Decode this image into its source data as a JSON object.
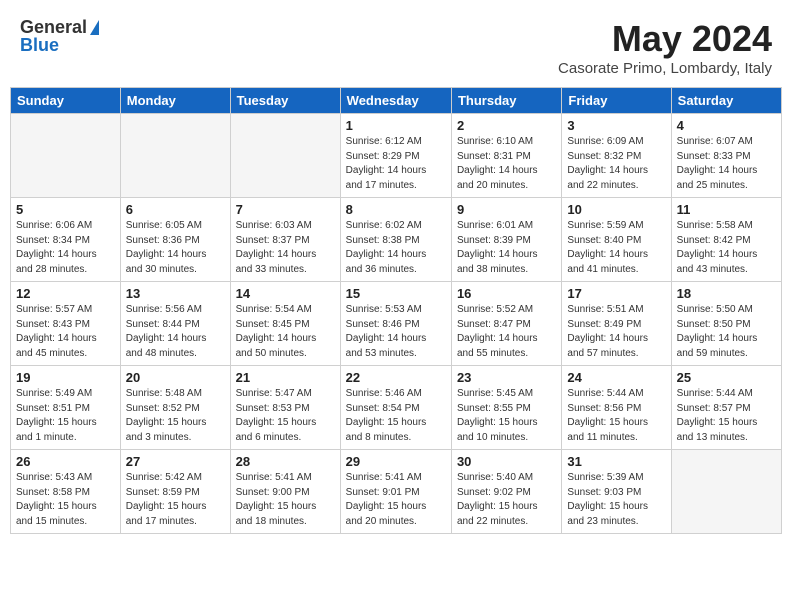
{
  "header": {
    "logo_general": "General",
    "logo_blue": "Blue",
    "month_title": "May 2024",
    "location": "Casorate Primo, Lombardy, Italy"
  },
  "weekdays": [
    "Sunday",
    "Monday",
    "Tuesday",
    "Wednesday",
    "Thursday",
    "Friday",
    "Saturday"
  ],
  "days": [
    {
      "num": "",
      "info": ""
    },
    {
      "num": "",
      "info": ""
    },
    {
      "num": "",
      "info": ""
    },
    {
      "num": "1",
      "info": "Sunrise: 6:12 AM\nSunset: 8:29 PM\nDaylight: 14 hours\nand 17 minutes."
    },
    {
      "num": "2",
      "info": "Sunrise: 6:10 AM\nSunset: 8:31 PM\nDaylight: 14 hours\nand 20 minutes."
    },
    {
      "num": "3",
      "info": "Sunrise: 6:09 AM\nSunset: 8:32 PM\nDaylight: 14 hours\nand 22 minutes."
    },
    {
      "num": "4",
      "info": "Sunrise: 6:07 AM\nSunset: 8:33 PM\nDaylight: 14 hours\nand 25 minutes."
    },
    {
      "num": "5",
      "info": "Sunrise: 6:06 AM\nSunset: 8:34 PM\nDaylight: 14 hours\nand 28 minutes."
    },
    {
      "num": "6",
      "info": "Sunrise: 6:05 AM\nSunset: 8:36 PM\nDaylight: 14 hours\nand 30 minutes."
    },
    {
      "num": "7",
      "info": "Sunrise: 6:03 AM\nSunset: 8:37 PM\nDaylight: 14 hours\nand 33 minutes."
    },
    {
      "num": "8",
      "info": "Sunrise: 6:02 AM\nSunset: 8:38 PM\nDaylight: 14 hours\nand 36 minutes."
    },
    {
      "num": "9",
      "info": "Sunrise: 6:01 AM\nSunset: 8:39 PM\nDaylight: 14 hours\nand 38 minutes."
    },
    {
      "num": "10",
      "info": "Sunrise: 5:59 AM\nSunset: 8:40 PM\nDaylight: 14 hours\nand 41 minutes."
    },
    {
      "num": "11",
      "info": "Sunrise: 5:58 AM\nSunset: 8:42 PM\nDaylight: 14 hours\nand 43 minutes."
    },
    {
      "num": "12",
      "info": "Sunrise: 5:57 AM\nSunset: 8:43 PM\nDaylight: 14 hours\nand 45 minutes."
    },
    {
      "num": "13",
      "info": "Sunrise: 5:56 AM\nSunset: 8:44 PM\nDaylight: 14 hours\nand 48 minutes."
    },
    {
      "num": "14",
      "info": "Sunrise: 5:54 AM\nSunset: 8:45 PM\nDaylight: 14 hours\nand 50 minutes."
    },
    {
      "num": "15",
      "info": "Sunrise: 5:53 AM\nSunset: 8:46 PM\nDaylight: 14 hours\nand 53 minutes."
    },
    {
      "num": "16",
      "info": "Sunrise: 5:52 AM\nSunset: 8:47 PM\nDaylight: 14 hours\nand 55 minutes."
    },
    {
      "num": "17",
      "info": "Sunrise: 5:51 AM\nSunset: 8:49 PM\nDaylight: 14 hours\nand 57 minutes."
    },
    {
      "num": "18",
      "info": "Sunrise: 5:50 AM\nSunset: 8:50 PM\nDaylight: 14 hours\nand 59 minutes."
    },
    {
      "num": "19",
      "info": "Sunrise: 5:49 AM\nSunset: 8:51 PM\nDaylight: 15 hours\nand 1 minute."
    },
    {
      "num": "20",
      "info": "Sunrise: 5:48 AM\nSunset: 8:52 PM\nDaylight: 15 hours\nand 3 minutes."
    },
    {
      "num": "21",
      "info": "Sunrise: 5:47 AM\nSunset: 8:53 PM\nDaylight: 15 hours\nand 6 minutes."
    },
    {
      "num": "22",
      "info": "Sunrise: 5:46 AM\nSunset: 8:54 PM\nDaylight: 15 hours\nand 8 minutes."
    },
    {
      "num": "23",
      "info": "Sunrise: 5:45 AM\nSunset: 8:55 PM\nDaylight: 15 hours\nand 10 minutes."
    },
    {
      "num": "24",
      "info": "Sunrise: 5:44 AM\nSunset: 8:56 PM\nDaylight: 15 hours\nand 11 minutes."
    },
    {
      "num": "25",
      "info": "Sunrise: 5:44 AM\nSunset: 8:57 PM\nDaylight: 15 hours\nand 13 minutes."
    },
    {
      "num": "26",
      "info": "Sunrise: 5:43 AM\nSunset: 8:58 PM\nDaylight: 15 hours\nand 15 minutes."
    },
    {
      "num": "27",
      "info": "Sunrise: 5:42 AM\nSunset: 8:59 PM\nDaylight: 15 hours\nand 17 minutes."
    },
    {
      "num": "28",
      "info": "Sunrise: 5:41 AM\nSunset: 9:00 PM\nDaylight: 15 hours\nand 18 minutes."
    },
    {
      "num": "29",
      "info": "Sunrise: 5:41 AM\nSunset: 9:01 PM\nDaylight: 15 hours\nand 20 minutes."
    },
    {
      "num": "30",
      "info": "Sunrise: 5:40 AM\nSunset: 9:02 PM\nDaylight: 15 hours\nand 22 minutes."
    },
    {
      "num": "31",
      "info": "Sunrise: 5:39 AM\nSunset: 9:03 PM\nDaylight: 15 hours\nand 23 minutes."
    },
    {
      "num": "",
      "info": ""
    }
  ]
}
